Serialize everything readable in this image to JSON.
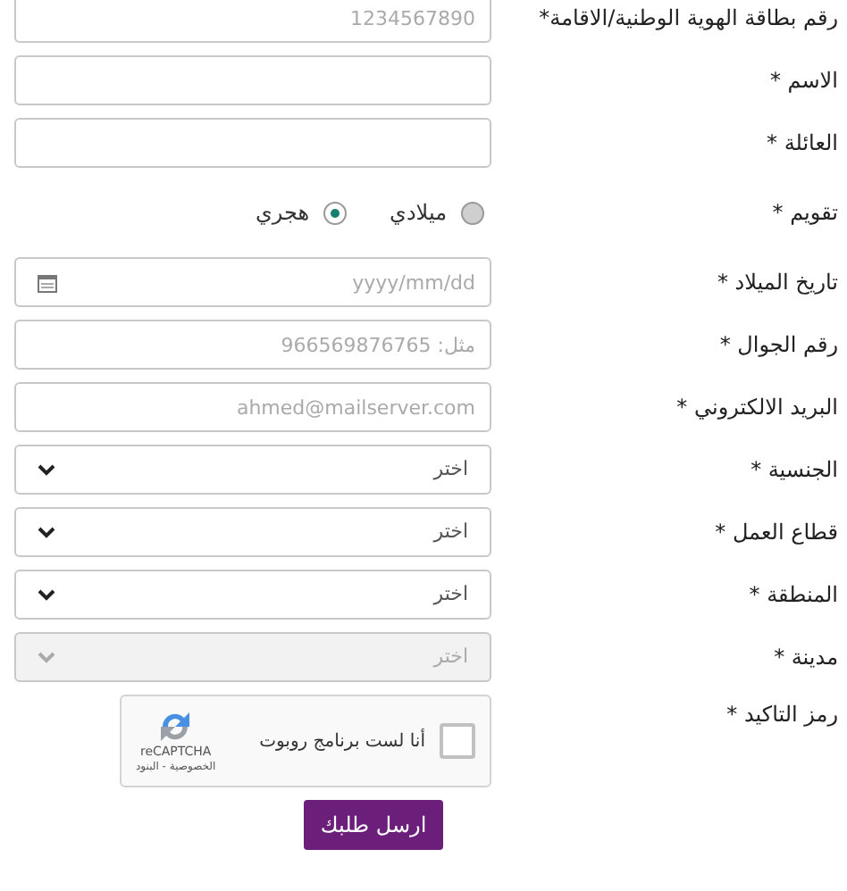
{
  "fields": [
    {
      "kind": "text",
      "label": "رقم بطاقة الهوية الوطنية/الاقامة*",
      "placeholder": "1234567890"
    },
    {
      "kind": "text",
      "label": "الاسم *"
    },
    {
      "kind": "text",
      "label": "العائلة *"
    },
    {
      "kind": "radio",
      "label": "تقويم *",
      "options": [
        {
          "label": "ميلادي",
          "selected": false
        },
        {
          "label": "هجري",
          "selected": true
        }
      ]
    },
    {
      "kind": "date",
      "label": "تاريخ الميلاد *",
      "placeholder": "yyyy/mm/dd"
    },
    {
      "kind": "text",
      "label": "رقم الجوال *",
      "placeholder": "مثل: 966569876765"
    },
    {
      "kind": "text",
      "label": "البريد الالكتروني *",
      "placeholder": "ahmed@mailserver.com"
    },
    {
      "kind": "select",
      "label": "الجنسية *",
      "value": "اختر",
      "disabled": false
    },
    {
      "kind": "select",
      "label": "قطاع العمل *",
      "value": "اختر",
      "disabled": false
    },
    {
      "kind": "select",
      "label": "المنطقة *",
      "value": "اختر",
      "disabled": false
    },
    {
      "kind": "select",
      "label": "مدينة *",
      "value": "اختر",
      "disabled": true
    },
    {
      "kind": "captcha",
      "label": "رمز التاكيد *",
      "checkbox_label": "أنا لست برنامج روبوت",
      "checked": false,
      "brand": "reCAPTCHA",
      "links": "الخصوصية - البنود"
    }
  ],
  "submit": "ارسل طلبك"
}
